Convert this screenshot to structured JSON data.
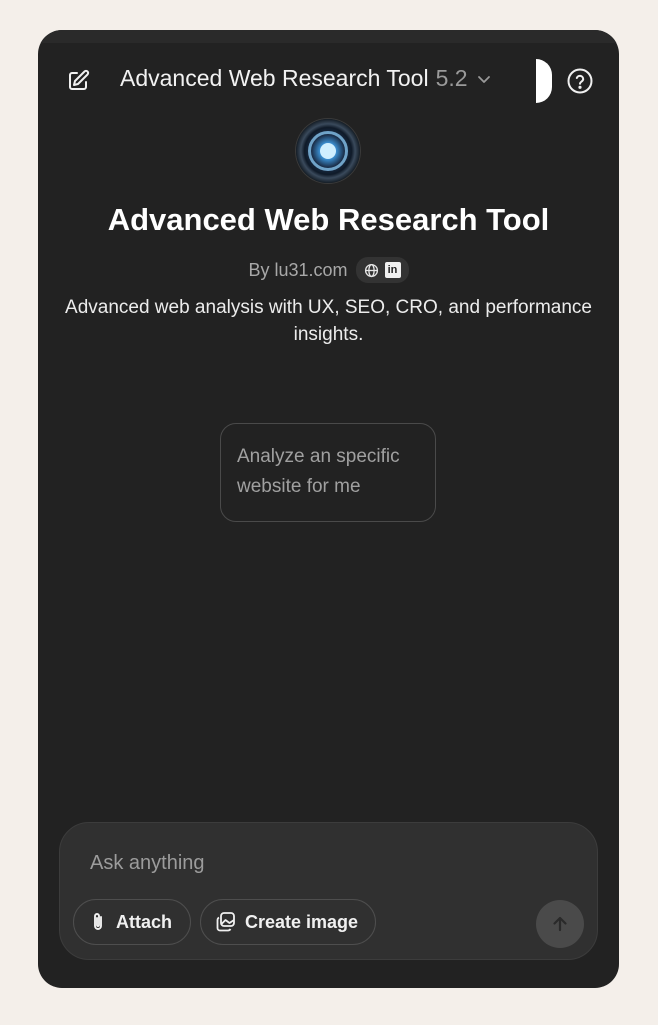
{
  "header": {
    "model_name": "Advanced Web Research Tool",
    "model_version": "5.2",
    "icons": {
      "edit": "compose-icon",
      "dropdown": "chevron-down-icon",
      "help": "help-circle-icon"
    }
  },
  "gpt": {
    "title": "Advanced Web Research Tool",
    "byline": "By lu31.com",
    "link_icons": [
      "globe-icon",
      "linkedin-icon"
    ],
    "linkedin_glyph": "in",
    "description": "Advanced web analysis with UX, SEO, CRO, and performance insights."
  },
  "starters": [
    {
      "label": "Analyze an specific website for me"
    }
  ],
  "composer": {
    "placeholder": "Ask anything",
    "attach_label": "Attach",
    "create_image_label": "Create image",
    "send_icon": "arrow-up-icon"
  },
  "colors": {
    "page_bg": "#f4efea",
    "panel_bg": "#222222",
    "composer_bg": "#303030",
    "text_primary": "#ffffff",
    "text_muted": "#a0a0a0"
  }
}
